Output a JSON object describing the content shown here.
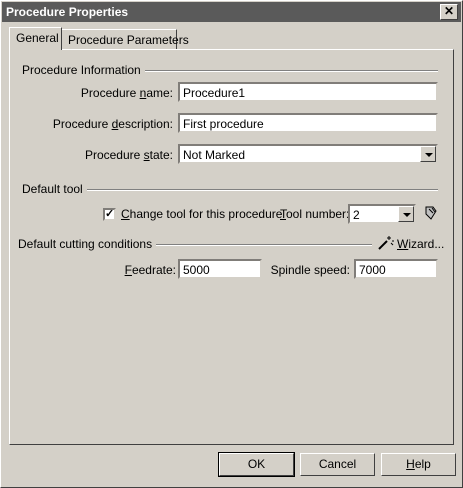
{
  "window": {
    "title": "Procedure Properties",
    "close_glyph": "✕"
  },
  "tabs": [
    {
      "label": "General",
      "active": true
    },
    {
      "label": "Procedure Parameters",
      "active": false
    }
  ],
  "procedure_info": {
    "group_label": "Procedure Information",
    "name_label": "Procedure name:",
    "name_value": "Procedure1",
    "description_label": "Procedure description:",
    "description_value": "First procedure",
    "state_label": "Procedure state:",
    "state_value": "Not Marked"
  },
  "default_tool": {
    "group_label": "Default tool",
    "change_tool_label": "Change tool for this procedure",
    "change_tool_checked": true,
    "tool_number_label": "Tool number:",
    "tool_number_value": "2"
  },
  "cutting": {
    "group_label": "Default cutting conditions",
    "wizard_label": "Wizard...",
    "feedrate_label": "Feedrate:",
    "feedrate_value": "5000",
    "spindle_label": "Spindle speed:",
    "spindle_value": "7000"
  },
  "buttons": {
    "ok": "OK",
    "cancel": "Cancel",
    "help": "Help"
  },
  "icons": {
    "tool": "tool-icon",
    "wizard": "wand-icon"
  }
}
